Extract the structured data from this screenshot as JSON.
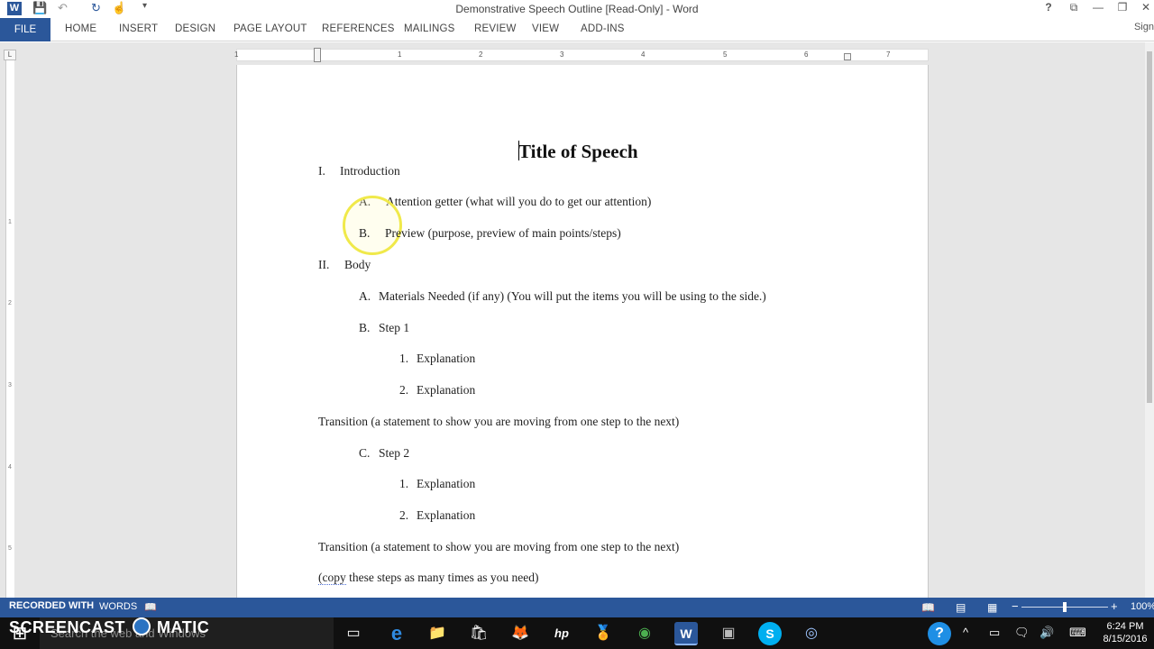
{
  "window": {
    "title": "Demonstrative Speech Outline [Read-Only] - Word",
    "help_glyph": "?",
    "restore_ribbon_glyph": "⧉",
    "minimize_glyph": "—",
    "maximize_glyph": "❐",
    "close_glyph": "✕"
  },
  "quick_access": {
    "word_icon": "W",
    "save_icon": "💾",
    "undo_icon": "↶",
    "redo_icon": "↻",
    "touch_icon": "☝",
    "customize_icon": "▾"
  },
  "ribbon": {
    "file_label": "FILE",
    "tabs": [
      "HOME",
      "INSERT",
      "DESIGN",
      "PAGE LAYOUT",
      "REFERENCES",
      "MAILINGS",
      "REVIEW",
      "VIEW",
      "ADD-INS"
    ],
    "signin_label": "Sign"
  },
  "ruler": {
    "tab_selector": "L",
    "numbers": [
      "1",
      "1",
      "2",
      "3",
      "4",
      "5",
      "6",
      "7"
    ],
    "vertical_numbers": [
      "1",
      "2",
      "3",
      "4",
      "5"
    ]
  },
  "document": {
    "title": "Title of Speech",
    "lines": [
      {
        "marker": "I.",
        "text": "Introduction"
      },
      {
        "marker": "A.",
        "text": "Attention getter (what will you do to get our attention)"
      },
      {
        "marker": "B.",
        "text": "Preview (purpose, preview of main points/steps)"
      },
      {
        "marker": "II.",
        "text": "Body"
      },
      {
        "marker": "A.",
        "text": "Materials Needed (if any) (You will put the items you will be using to the side.)"
      },
      {
        "marker": "B.",
        "text": "Step 1"
      },
      {
        "marker": "1.",
        "text": "Explanation"
      },
      {
        "marker": "2.",
        "text": "Explanation"
      },
      {
        "marker": "",
        "text": "Transition (a statement to show you are moving from one step to the next)"
      },
      {
        "marker": "C.",
        "text": "Step 2"
      },
      {
        "marker": "1.",
        "text": "Explanation"
      },
      {
        "marker": "2.",
        "text": "Explanation"
      },
      {
        "marker": "",
        "text": "Transition (a statement to show you are moving from one step to the next)"
      },
      {
        "marker": "",
        "text_underlined": "(copy",
        "text": " these steps as many times as you need)"
      }
    ]
  },
  "status_bar": {
    "recorded_label": "RECORDED WITH",
    "words_label": "WORDS",
    "proofing_icon": "📖",
    "zoom_minus": "−",
    "zoom_plus": "+",
    "zoom_level": "100%",
    "zoom_fraction": 0.5
  },
  "watermark": {
    "left": "SCREENCAST",
    "right": "MATIC"
  },
  "taskbar": {
    "search_placeholder": "Search the web and Windows",
    "clock_time": "6:24 PM",
    "clock_date": "8/15/2016",
    "start_icon": "⊞",
    "task_view_icon": "▭",
    "edge_icon": "e",
    "explorer_icon": "📁",
    "store_icon": "🛍",
    "firefox_icon": "🦊",
    "hp_icon": "hp",
    "badge_icon": "🏅",
    "chrome_icon": "◉",
    "word_icon": "W",
    "app_icon": "▣",
    "skype_icon": "S",
    "recorder_icon": "◎",
    "help_icon": "?",
    "tray_chevron": "^",
    "battery_icon": "▭",
    "notifications_icon": "🗨",
    "volume_icon": "🔊",
    "keyboard_icon": "⌨"
  }
}
